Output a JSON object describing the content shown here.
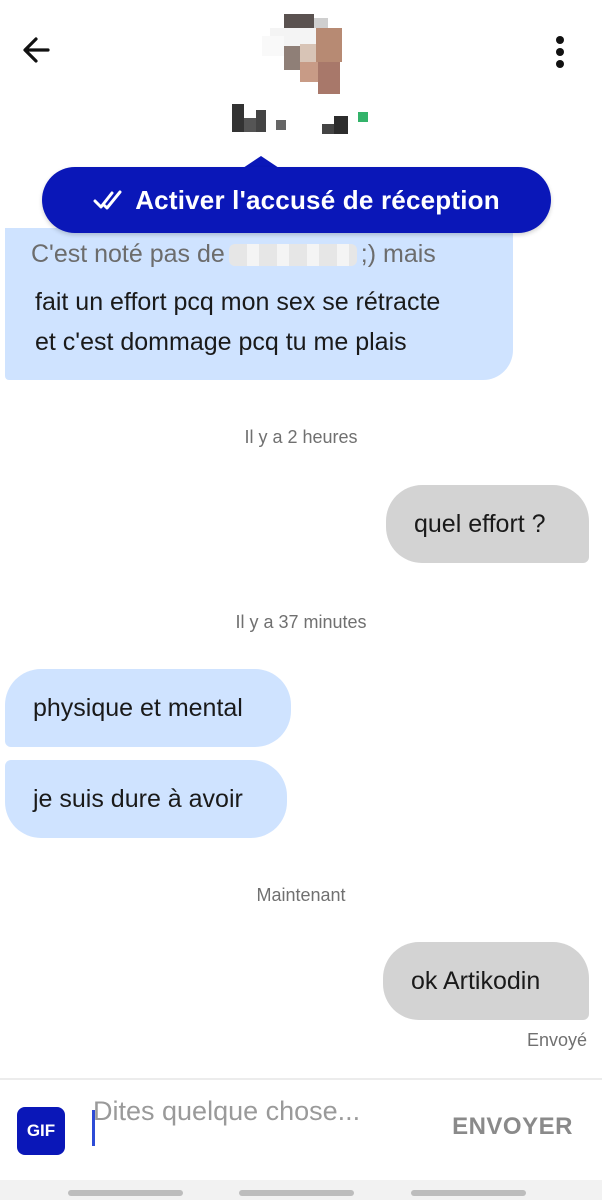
{
  "header": {
    "back_icon": "arrow-left-icon",
    "more_icon": "vertical-dots-icon"
  },
  "receipt_banner": {
    "label": "Activer l'accusé de réception",
    "icon": "double-check-icon",
    "color": "#0a17b8"
  },
  "messages": [
    {
      "direction": "in",
      "partial_line": "C'est noté pas de",
      "partial_line_end": ";) mais",
      "lines": [
        "fait un effort pcq mon sex se rétracte",
        "et c'est dommage pcq tu me plais"
      ]
    },
    {
      "type": "timestamp",
      "text": "Il y a 2 heures"
    },
    {
      "direction": "out",
      "text": "quel effort ?"
    },
    {
      "type": "timestamp",
      "text": "Il y a 37 minutes"
    },
    {
      "direction": "in",
      "text": "physique et mental"
    },
    {
      "direction": "in",
      "text": "je suis dure à avoir"
    },
    {
      "type": "timestamp",
      "text": "Maintenant"
    },
    {
      "direction": "out",
      "text": "ok Artikodin",
      "status": "Envoyé"
    }
  ],
  "composer": {
    "gif_label": "GIF",
    "placeholder": "Dites quelque chose...",
    "value": "",
    "send_label": "ENVOYER"
  },
  "colors": {
    "incoming_bubble": "#cfe3ff",
    "outgoing_bubble": "#d3d3d3",
    "brand": "#0a17b8"
  }
}
